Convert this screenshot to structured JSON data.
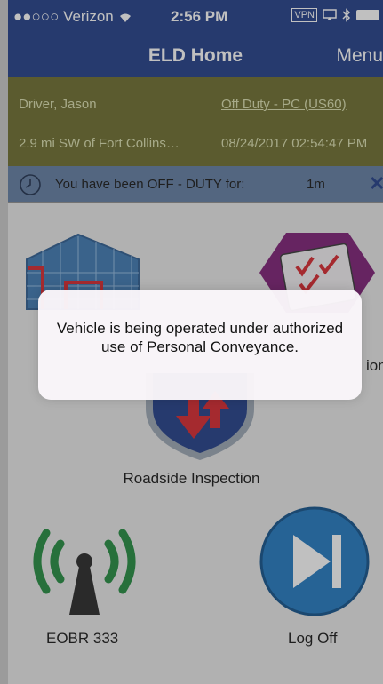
{
  "status_bar": {
    "carrier": "●●○○○ Verizon",
    "time": "2:56 PM",
    "vpn": "VPN"
  },
  "nav": {
    "title": "ELD Home",
    "menu_label": "Menu"
  },
  "driver_info": {
    "driver": "Driver, Jason",
    "duty_status": "Off Duty - PC (US60)",
    "location": "2.9 mi SW of Fort Collins…",
    "timestamp": "08/24/2017 02:54:47 PM"
  },
  "timer": {
    "text": "You have been OFF - DUTY for:",
    "value": "1m",
    "close": "✕"
  },
  "tiles": {
    "logs_partial_label": "ion",
    "roadside": "Roadside Inspection",
    "eobr": "EOBR 333",
    "logoff": "Log Off"
  },
  "alert": {
    "message": "Vehicle is being operated under authorized use of Personal Conveyance."
  },
  "colors": {
    "nav_blue": "#1d3a86",
    "info_olive": "#6b6b2a",
    "timer_blue": "#5f7ba1",
    "eobr_green": "#1e8a3c",
    "logoff_blue": "#1d77c0",
    "roadside_red": "#d8232a",
    "logs_purple": "#7b1a73"
  },
  "icons": [
    "wifi-icon",
    "vpn-icon",
    "bluetooth-icon",
    "battery-icon",
    "clock-icon",
    "close-icon",
    "floor-plan-icon",
    "logs-checklist-icon",
    "roadside-shield-icon",
    "antenna-icon",
    "log-off-icon"
  ]
}
